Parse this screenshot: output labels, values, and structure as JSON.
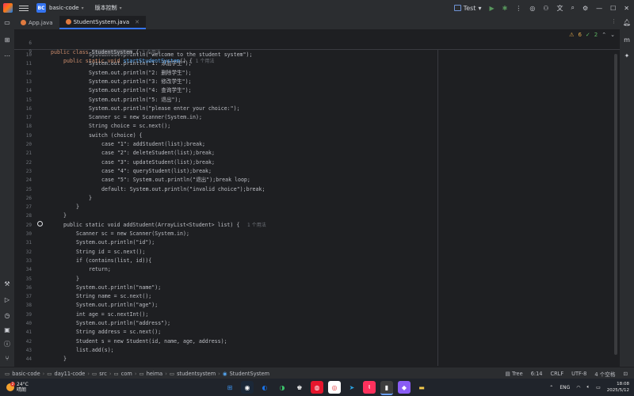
{
  "window": {
    "project_name": "basic-code",
    "project_badge": "BC",
    "vcs_label": "版本控制",
    "run_config": "Test"
  },
  "tabs": [
    {
      "label": "App.java",
      "active": false
    },
    {
      "label": "StudentSystem.java",
      "active": true
    }
  ],
  "inspections": {
    "warnings": "6",
    "ok": "2"
  },
  "sticky_lines": [
    {
      "num": "6",
      "pre": "public class ",
      "cls": "StudentSystem",
      "post": " {",
      "hint": "3 个用法"
    },
    {
      "num": "9",
      "pre": "public static void ",
      "mth": "startStudentSystem",
      "post": "() {",
      "hint": "1 个用法"
    }
  ],
  "code_lines": [
    {
      "num": "10",
      "text": "System.out.println(\"welcome to the student system\");"
    },
    {
      "num": "11",
      "text": "System.out.println(\"1: 添加学生\");"
    },
    {
      "num": "12",
      "text": "System.out.println(\"2: 删除学生\");"
    },
    {
      "num": "13",
      "text": "System.out.println(\"3: 修改学生\");"
    },
    {
      "num": "14",
      "text": "System.out.println(\"4: 查询学生\");"
    },
    {
      "num": "15",
      "text": "System.out.println(\"5: 退出\");"
    },
    {
      "num": "16",
      "text": "System.out.println(\"please enter your choice:\");"
    },
    {
      "num": "17",
      "text": "Scanner sc = new Scanner(System.in);"
    },
    {
      "num": "18",
      "text": "String choice = sc.next();"
    },
    {
      "num": "19",
      "text": "switch (choice) {"
    },
    {
      "num": "20",
      "text": "case \"1\": addStudent(list);break;"
    },
    {
      "num": "21",
      "text": "case \"2\": deleteStudent(list);break;"
    },
    {
      "num": "22",
      "text": "case \"3\": updateStudent(list);break;"
    },
    {
      "num": "23",
      "text": "case \"4\": queryStudent(list);break;"
    },
    {
      "num": "24",
      "text": "case \"5\": System.out.println(\"退出\");break loop;"
    },
    {
      "num": "25",
      "text": "default: System.out.println(\"invalid choice\");break;"
    },
    {
      "num": "26",
      "text": "}"
    },
    {
      "num": "27",
      "text": "}"
    },
    {
      "num": "28",
      "text": "}"
    },
    {
      "num": "29",
      "text": "public static void addStudent(ArrayList<Student> list) {",
      "hint": "1 个用法"
    },
    {
      "num": "30",
      "text": "Scanner sc = new Scanner(System.in);"
    },
    {
      "num": "31",
      "text": "System.out.println(\"id\");"
    },
    {
      "num": "32",
      "text": "String id = sc.next();"
    },
    {
      "num": "33",
      "text": "if (contains(list, id)){"
    },
    {
      "num": "34",
      "text": "return;"
    },
    {
      "num": "35",
      "text": "}"
    },
    {
      "num": "36",
      "text": "System.out.println(\"name\");"
    },
    {
      "num": "37",
      "text": "String name = sc.next();"
    },
    {
      "num": "38",
      "text": "System.out.println(\"age\");"
    },
    {
      "num": "39",
      "text": "int age = sc.nextInt();"
    },
    {
      "num": "40",
      "text": "System.out.println(\"address\");"
    },
    {
      "num": "41",
      "text": "String address = sc.next();"
    },
    {
      "num": "42",
      "text": "Student s = new Student(id, name, age, address);"
    },
    {
      "num": "43",
      "text": "list.add(s);"
    },
    {
      "num": "44",
      "text": "}"
    }
  ],
  "breadcrumb": [
    "basic-code",
    "day11-code",
    "src",
    "com",
    "heima",
    "studentsystem",
    "StudentSystem"
  ],
  "status": {
    "tree": "Tree",
    "position": "6:14",
    "line_sep": "CRLF",
    "encoding": "UTF-8",
    "indent": "4 个空格"
  },
  "taskbar": {
    "weather_temp": "24°C",
    "weather_desc": "晴朗",
    "weather_badge": "2",
    "lang": "ENG",
    "time": "18:08",
    "date": "2025/5/12"
  }
}
